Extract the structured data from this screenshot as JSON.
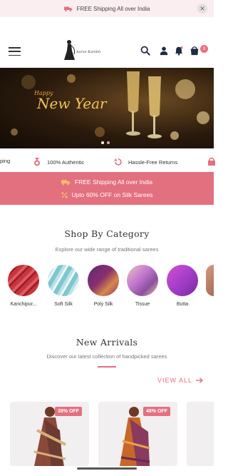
{
  "topbar": {
    "text": "FREE Shipping All over India",
    "close": "✕"
  },
  "header": {
    "cart_count": "0",
    "logo_text": "Saree Kambh"
  },
  "banner": {
    "happy": "Happy",
    "new_year": "New Year",
    "slides": 2,
    "active_slide": 1
  },
  "features": {
    "items": [
      {
        "icon": "truck-icon",
        "label": "ping"
      },
      {
        "icon": "medal-icon",
        "label": "100% Authentic"
      },
      {
        "icon": "return-icon",
        "label": "Hassle-Free Returns"
      }
    ]
  },
  "promo": {
    "line1": "FREE Shipping All over India",
    "line2": "Upto 60% OFF on Silk Sarees"
  },
  "categories": {
    "title": "Shop By Category",
    "subtitle": "Explore our wide range of traditional sarees",
    "items": [
      {
        "label": "Kanchipur...",
        "color": "#c9353e"
      },
      {
        "label": "Soft Silk",
        "color": "#7fc6cf"
      },
      {
        "label": "Poly Silk",
        "color": "#8a2f6d"
      },
      {
        "label": "Tissue",
        "color": "#8c4f9e"
      },
      {
        "label": "Butta",
        "color": "#a33ec8"
      }
    ]
  },
  "new_arrivals": {
    "title": "New Arrivals",
    "subtitle": "Discover our latest collection of handpicked sarees",
    "view_all": "VIEW ALL",
    "products": [
      {
        "discount": "38% OFF"
      },
      {
        "discount": "48% OFF"
      }
    ]
  },
  "colors": {
    "accent": "#e3707f",
    "topbar_bg": "#fbeef0"
  }
}
